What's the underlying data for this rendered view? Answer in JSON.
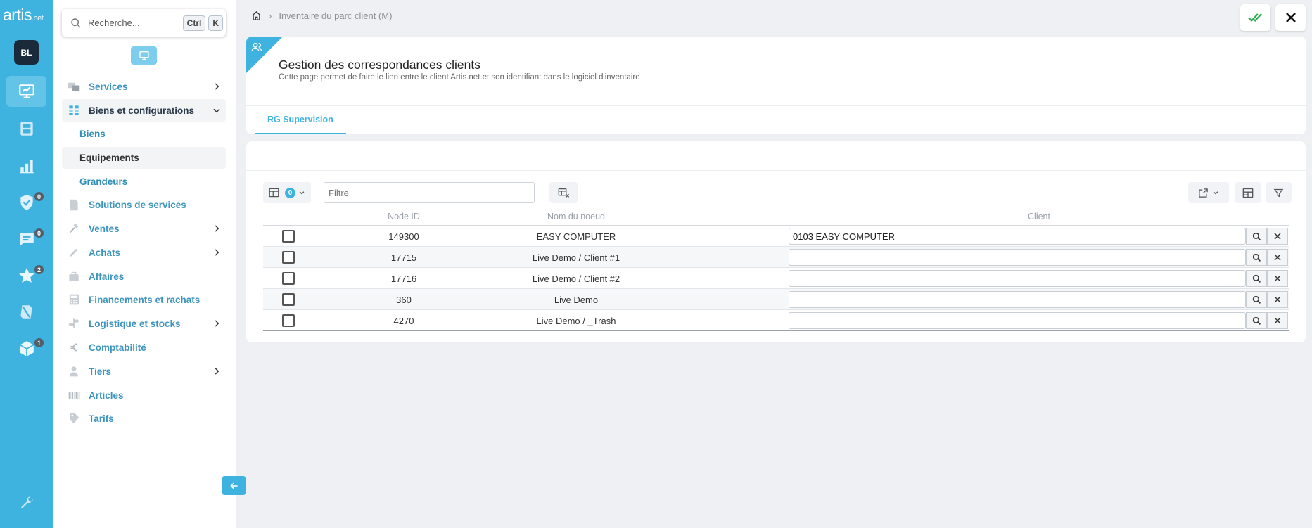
{
  "app": {
    "logo_main": "artis",
    "logo_suffix": ".net",
    "user_initials": "BL"
  },
  "rail": {
    "badges": {
      "checks": "0",
      "messages": "0",
      "favorites": "2",
      "packages": "1"
    }
  },
  "sidebar": {
    "search_placeholder": "Recherche...",
    "shortcut_ctrl": "Ctrl",
    "shortcut_k": "K",
    "items": [
      {
        "label": "Services"
      },
      {
        "label": "Biens et configurations"
      },
      {
        "label": "Biens"
      },
      {
        "label": "Equipements"
      },
      {
        "label": "Grandeurs"
      },
      {
        "label": "Solutions de services"
      },
      {
        "label": "Ventes"
      },
      {
        "label": "Achats"
      },
      {
        "label": "Affaires"
      },
      {
        "label": "Financements et rachats"
      },
      {
        "label": "Logistique et stocks"
      },
      {
        "label": "Comptabilité"
      },
      {
        "label": "Tiers"
      },
      {
        "label": "Articles"
      },
      {
        "label": "Tarifs"
      }
    ]
  },
  "breadcrumb": {
    "separator": "›",
    "current": "Inventaire du parc client (M)"
  },
  "header": {
    "title": "Gestion des correspondances clients",
    "subtitle": "Cette page permet de faire le lien entre le client Artis.net et son identifiant dans le logiciel d'inventaire",
    "tabs": [
      {
        "label": "RG Supervision"
      }
    ]
  },
  "toolbar": {
    "selected_count": "0",
    "filter_placeholder": "Filtre"
  },
  "table": {
    "columns": {
      "node_id": "Node ID",
      "node_name": "Nom du noeud",
      "client": "Client"
    },
    "rows": [
      {
        "node_id": "149300",
        "node_name": "EASY COMPUTER",
        "client": "0103 EASY COMPUTER"
      },
      {
        "node_id": "17715",
        "node_name": "Live Demo / Client #1",
        "client": ""
      },
      {
        "node_id": "17716",
        "node_name": "Live Demo / Client #2",
        "client": ""
      },
      {
        "node_id": "360",
        "node_name": "Live Demo",
        "client": ""
      },
      {
        "node_id": "4270",
        "node_name": "Live Demo / _Trash",
        "client": ""
      }
    ]
  },
  "colors": {
    "accent": "#3fb3df",
    "dark": "#1b2a3a",
    "success": "#2eae4f"
  }
}
